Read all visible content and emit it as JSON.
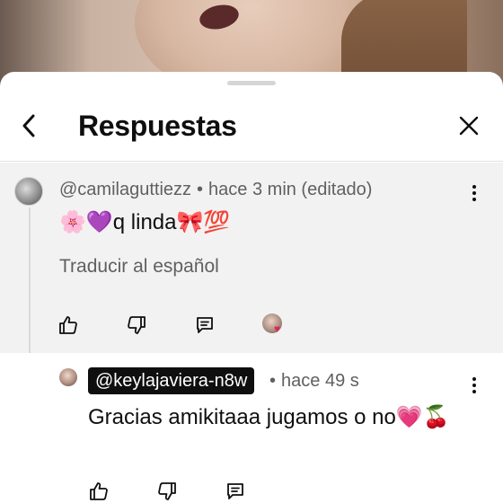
{
  "header": {
    "title": "Respuestas"
  },
  "parent_comment": {
    "handle": "@camilaguttiezz",
    "separator": "•",
    "time": "hace 3 min (editado)",
    "text": "🌸💜q linda🎀💯",
    "translate_label": "Traducir al español"
  },
  "reply": {
    "handle": "@keylajaviera-n8w",
    "separator": "•",
    "time": "hace 49 s",
    "text": "Gracias amikitaaa jugamos o no💗🍒"
  },
  "colors": {
    "sheet_bg": "#ffffff",
    "highlight_bg": "#f2f2f2",
    "text_primary": "#0f0f0f",
    "text_secondary": "#606060",
    "creator_heart": "#e0245e"
  }
}
